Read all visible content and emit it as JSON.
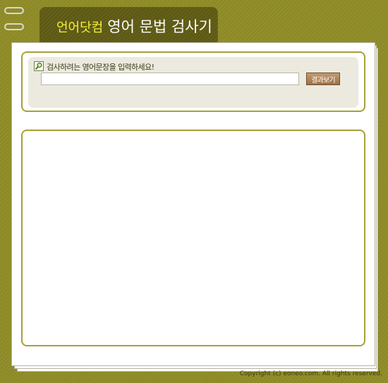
{
  "header": {
    "brand": "언어닷컴",
    "title": "영어 문법 검사기"
  },
  "search": {
    "prompt": "검사하려는 영어문장을 입력하세요!",
    "input_value": "",
    "button_label": "결과보기"
  },
  "result": {
    "text": ""
  },
  "footer": {
    "copyright": "Copyright (c) eoneo.com.  All rights reserved."
  },
  "colors": {
    "background": "#8d8a26",
    "tab": "#5e5a14",
    "brand_text": "#f3ee3a",
    "box_border": "#a7a03a",
    "search_panel": "#eceadf",
    "button": "#a57a50"
  },
  "icons": {
    "rings": "binder-ring-icon",
    "search": "magnifier-icon"
  }
}
